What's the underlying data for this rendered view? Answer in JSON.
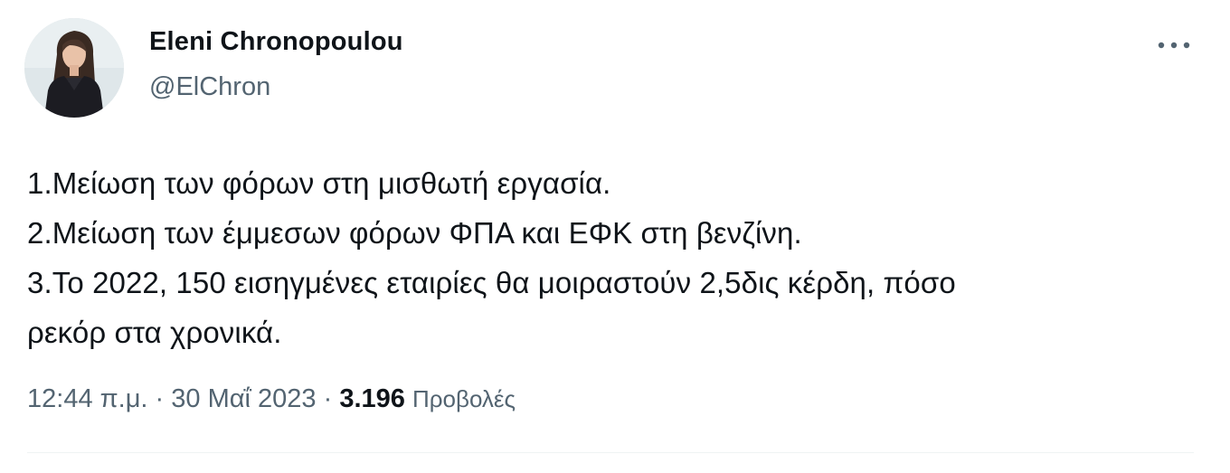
{
  "author": {
    "name": "Eleni Chronopoulou",
    "handle": "@ElChron"
  },
  "more_menu": {
    "icon": "more-horizontal-icon"
  },
  "tweet": {
    "lines": [
      "1.Μείωση των φόρων στη μισθωτή εργασία.",
      "2.Μείωση των έμμεσων φόρων ΦΠΑ και ΕΦΚ στη βενζίνη.",
      "3.Το 2022, 150 εισηγμένες εταιρίες θα μοιραστούν 2,5δις κέρδη, πόσο",
      "ρεκόρ στα χρονικά."
    ]
  },
  "meta": {
    "time": "12:44 π.μ.",
    "separator": "·",
    "date": "30 Μαΐ 2023",
    "views_count": "3.196",
    "views_label": "Προβολές"
  },
  "colors": {
    "text_primary": "#0f1419",
    "text_secondary": "#536471",
    "divider": "#eff3f4"
  }
}
